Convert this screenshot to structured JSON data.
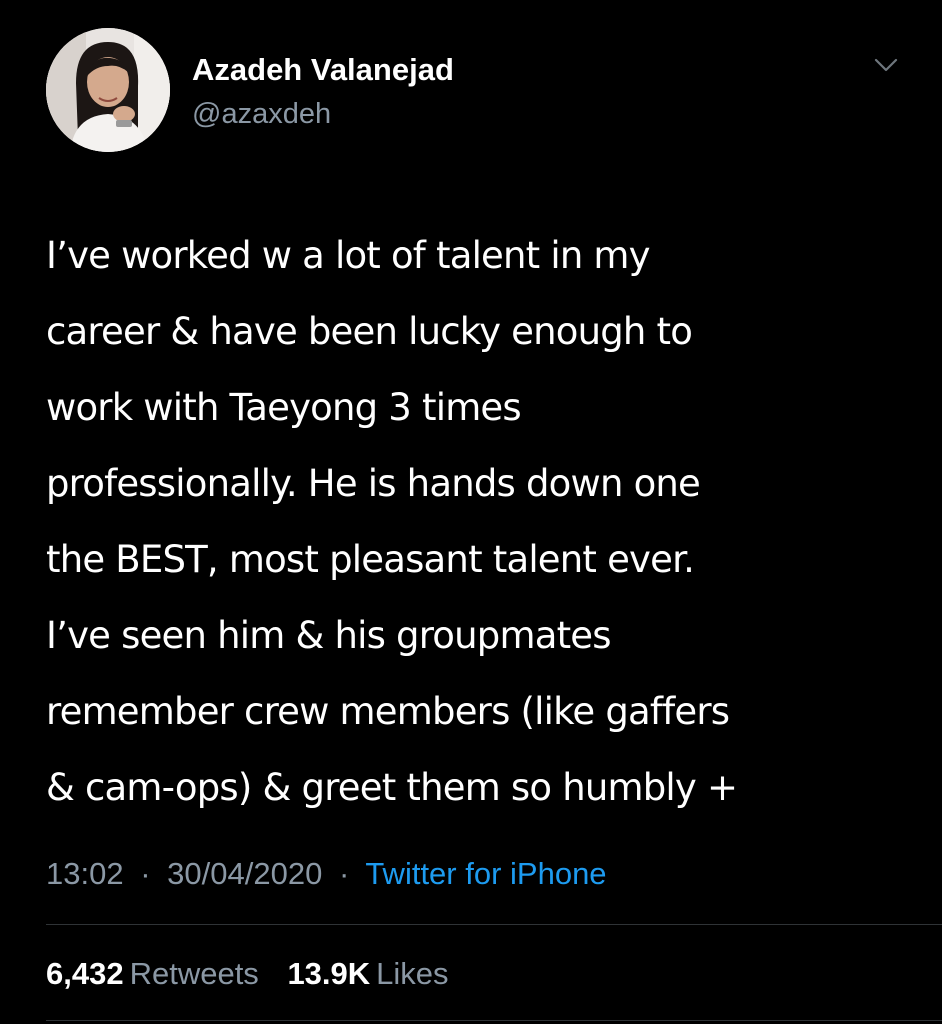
{
  "tweet": {
    "author": {
      "display_name": "Azadeh Valanejad",
      "handle": "@azaxdeh",
      "avatar_icon": "profile-photo"
    },
    "menu_icon": "chevron-down-icon",
    "body_lines": [
      "I’ve worked w a lot of talent in my",
      "career & have been lucky enough to",
      "work with Taeyong 3 times",
      "professionally. He is hands down one",
      "the BEST, most pleasant talent ever.",
      "I’ve seen him & his groupmates",
      "remember crew members (like gaffers",
      "& cam-ops) & greet them so humbly +"
    ],
    "time": "13:02",
    "date": "30/04/2020",
    "separator": "·",
    "source": "Twitter for iPhone",
    "stats": {
      "retweets_count": "6,432",
      "retweets_label": "Retweets",
      "likes_count": "13.9K",
      "likes_label": "Likes"
    }
  },
  "colors": {
    "background": "#000000",
    "primary_text": "#ffffff",
    "secondary_text": "#8b98a5",
    "link": "#1d9bf0",
    "divider": "#2f3336"
  }
}
